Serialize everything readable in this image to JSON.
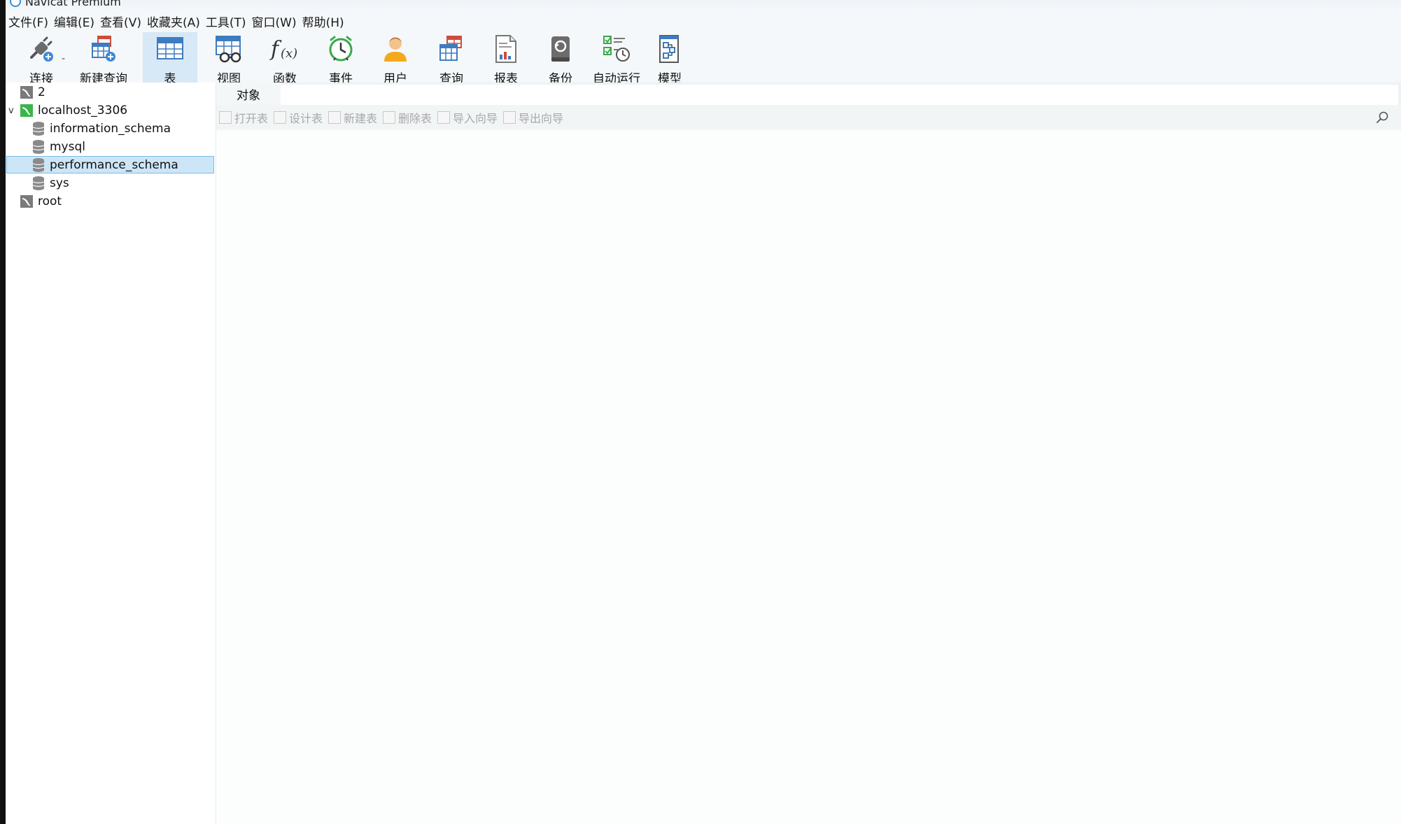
{
  "window": {
    "title": "Navicat Premium"
  },
  "menu": [
    "文件(F)",
    "编辑(E)",
    "查看(V)",
    "收藏夹(A)",
    "工具(T)",
    "窗口(W)",
    "帮助(H)"
  ],
  "toolbar": {
    "connect": "连接",
    "new_query": "新建查询",
    "table": "表",
    "view": "视图",
    "function": "函数",
    "event": "事件",
    "user": "用户",
    "query": "查询",
    "report": "报表",
    "backup": "备份",
    "automation": "自动运行",
    "model": "模型",
    "dash": "-"
  },
  "tree": {
    "connections": [
      {
        "label": "2",
        "expanded": false
      },
      {
        "label": "localhost_3306",
        "expanded": true,
        "expander": "v"
      },
      {
        "label": "root",
        "expanded": false
      }
    ],
    "databases": [
      {
        "label": "information_schema"
      },
      {
        "label": "mysql"
      },
      {
        "label": "performance_schema",
        "selected": true
      },
      {
        "label": "sys"
      }
    ]
  },
  "content": {
    "tab_label": "对象",
    "object_toolbar": {
      "open_table": "打开表",
      "design_table": "设计表",
      "new_table": "新建表",
      "delete_table": "删除表",
      "import_wizard": "导入向导",
      "export_wizard": "导出向导"
    }
  },
  "colors": {
    "selection_bg": "#cde6f7",
    "selection_border": "#7dbbe5",
    "active_toolbar": "#d7e8f6",
    "disabled_text": "#a8a8a8"
  }
}
